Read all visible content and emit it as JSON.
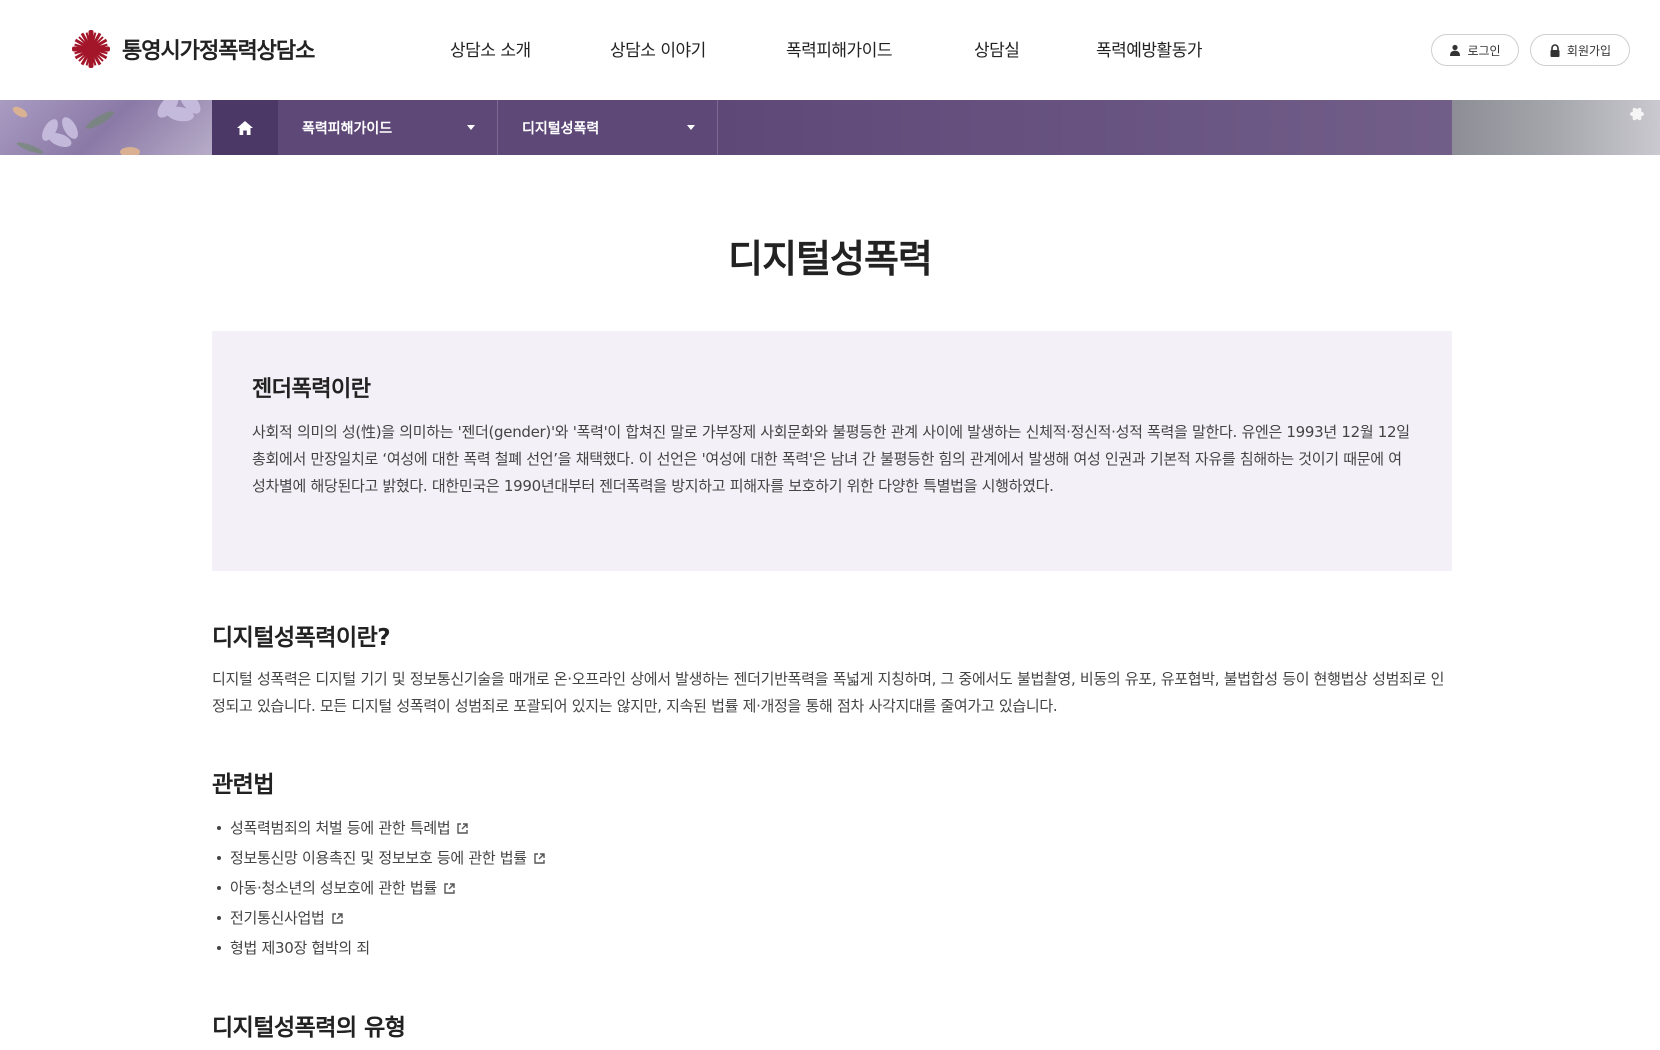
{
  "header": {
    "logo_text": "통영시가정폭력상담소",
    "nav": [
      "상담소 소개",
      "상담소 이야기",
      "폭력피해가이드",
      "상담실",
      "폭력예방활동가"
    ],
    "login_label": "로그인",
    "signup_label": "회원가입"
  },
  "breadcrumb": {
    "level1": "폭력피해가이드",
    "level2": "디지털성폭력"
  },
  "page_title": "디지털성폭력",
  "gender_box": {
    "title": "젠더폭력이란",
    "body": "사회적 의미의 성(性)을 의미하는 '젠더(gender)'와 '폭력'이 합쳐진 말로 가부장제 사회문화와 불평등한 관계 사이에 발생하는 신체적·정신적·성적 폭력을 말한다. 유엔은 1993년 12월 12일 총회에서 만장일치로 ‘여성에 대한 폭력 철폐 선언’을 채택했다. 이 선언은 '여성에 대한 폭력'은 남녀 간 불평등한 힘의 관계에서 발생해 여성 인권과 기본적 자유를 침해하는 것이기 때문에 여성차별에 해당된다고 밝혔다. 대한민국은 1990년대부터 젠더폭력을 방지하고 피해자를 보호하기 위한 다양한 특별법을 시행하였다."
  },
  "digital_section": {
    "title": "디지털성폭력이란?",
    "body": "디지털 성폭력은 디지털 기기 및 정보통신기술을 매개로 온·오프라인 상에서 발생하는 젠더기반폭력을 폭넓게 지칭하며, 그 중에서도 불법촬영, 비동의 유포, 유포협박, 불법합성 등이 현행법상 성범죄로 인정되고 있습니다. 모든 디지털 성폭력이 성범죄로 포괄되어 있지는 않지만, 지속된 법률 제·개정을 통해 점차 사각지대를 줄여가고 있습니다."
  },
  "laws_section": {
    "title": "관련법",
    "items": [
      "성폭력범죄의 처벌 등에 관한 특례법",
      "정보통신망 이용촉진 및 정보보호 등에 관한 법률",
      "아동·청소년의 성보호에 관한 법률",
      "전기통신사업법",
      "형법 제30장 협박의 죄"
    ]
  },
  "types_section": {
    "title": "디지털성폭력의 유형"
  },
  "colors": {
    "brand_red": "#a3162a",
    "banner_purple": "#5e4878",
    "home_purple": "#4c3866",
    "box_bg": "#f3f1f7"
  },
  "icons": {
    "logo": "caritas-cross-icon",
    "home": "home-icon",
    "login": "user-icon",
    "signup": "lock-icon",
    "external": "external-link-icon"
  }
}
